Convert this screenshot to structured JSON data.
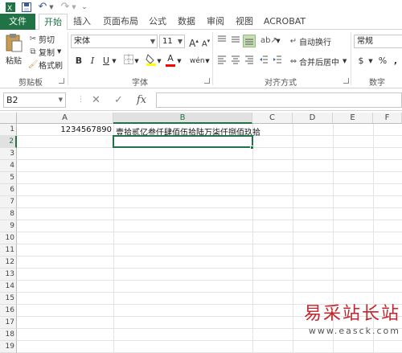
{
  "qat": {
    "save_icon": "save-icon",
    "undo_icon": "undo-icon",
    "redo_icon": "redo-icon",
    "customize_icon": "customize-qat-icon"
  },
  "tabs": [
    "文件",
    "开始",
    "插入",
    "页面布局",
    "公式",
    "数据",
    "审阅",
    "视图",
    "ACROBAT"
  ],
  "ribbon": {
    "clipboard": {
      "paste": "粘贴",
      "cut": "剪切",
      "copy": "复制",
      "format_painter": "格式刷",
      "label": "剪贴板"
    },
    "font": {
      "font_name": "宋体",
      "font_size": "11",
      "bold": "B",
      "italic": "I",
      "underline": "U",
      "font_color_letter": "A",
      "phonetic": "wén",
      "label": "字体"
    },
    "alignment": {
      "wrap_text": "自动换行",
      "merge_center": "合并后居中",
      "label": "对齐方式"
    },
    "number": {
      "format": "常规",
      "currency_symbol": "$",
      "percent": "%",
      "comma": ",",
      "label": "数字"
    }
  },
  "formula_bar": {
    "name_box": "B2",
    "cancel": "✕",
    "enter": "✓",
    "fx": "fx",
    "content": ""
  },
  "sheet": {
    "columns": [
      "A",
      "B",
      "C",
      "D",
      "E",
      "F"
    ],
    "rows": [
      "1",
      "2",
      "3",
      "4",
      "5",
      "6",
      "7",
      "8",
      "9",
      "10",
      "11",
      "12",
      "13",
      "14",
      "15",
      "16",
      "17",
      "18",
      "19"
    ],
    "cells": {
      "A1": "1234567890",
      "B1": "壹拾贰亿叁仟肆佰伍拾陆万柒仟捌佰玖拾"
    },
    "selected_cell": "B2"
  },
  "watermark": {
    "text": "易采站长站",
    "url": "www.easck.com"
  }
}
